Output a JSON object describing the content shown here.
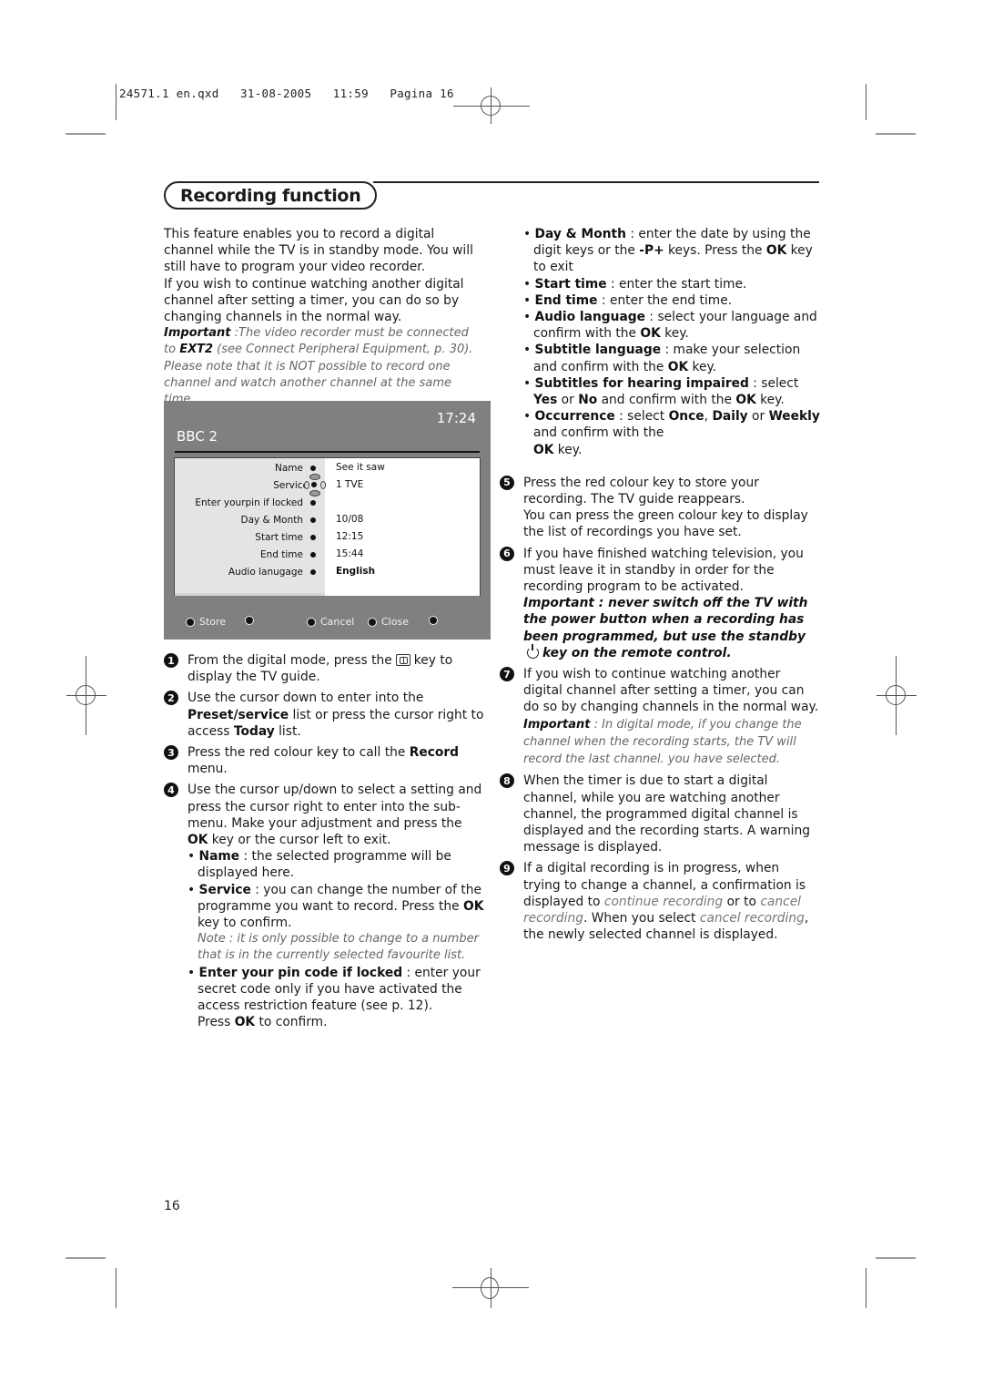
{
  "slug": "24571.1 en.qxd   31-08-2005   11:59   Pagina 16",
  "title": "Recording function",
  "intro": {
    "p1": "This feature enables you to record a digital channel while the TV is in standby mode. You will still have to program your video recorder.",
    "p2": "If you wish to continue watching another digital channel after setting a timer, you can do so by changing channels in the normal way.",
    "important_label": "Important",
    "important_text1": " :The video recorder must be connected to ",
    "ext2": "EXT2",
    "important_text2": " (see Connect Peripheral Equipment, p. 30). Please note that it is NOT possible to record one channel and watch another channel at the same time."
  },
  "tv_screen": {
    "time": "17:24",
    "channel": "BBC 2",
    "rows": [
      {
        "label": "Name",
        "value": "See it saw"
      },
      {
        "label": "Service",
        "value": "1 TVE"
      },
      {
        "label": "Enter yourpin if locked",
        "value": ""
      },
      {
        "label": "Day & Month",
        "value": "10/08"
      },
      {
        "label": "Start time",
        "value": "12:15"
      },
      {
        "label": "End time",
        "value": "15:44"
      },
      {
        "label": "Audio lanugage",
        "value": "English"
      }
    ],
    "footer": {
      "store": "Store",
      "cancel": "Cancel",
      "close": "Close"
    }
  },
  "steps": {
    "s1": {
      "num": "1",
      "a": "From the digital mode, press the",
      "b": "key to display the TV guide."
    },
    "s2": {
      "num": "2",
      "a": "Use the cursor down to enter into the ",
      "b1": "Preset/service",
      "c": " list or press the cursor right to access ",
      "b2": "Today",
      "d": " list."
    },
    "s3": {
      "num": "3",
      "a": "Press the red colour key to call the ",
      "b": "Record",
      "c": " menu."
    },
    "s4": {
      "num": "4",
      "a": "Use the cursor up/down to select a setting and press the cursor right to enter into the sub-menu. Make your adjustment and press the ",
      "ok": "OK",
      "b": " key or the cursor left to exit."
    },
    "s5": {
      "num": "5",
      "text": "Press the red colour key to store your recording. The TV guide reappears.",
      "text2": "You can press the green colour key to display the list of recordings you have set."
    },
    "s6": {
      "num": "6",
      "text": "If you have finished watching television, you must leave it in standby in order for the recording program to be activated.",
      "imp_a": "Important : never switch off the TV with the power button when a recording has been programmed, but use the standby",
      "imp_b": "key on the remote control."
    },
    "s7": {
      "num": "7",
      "text": "If you wish to continue watching another digital channel after setting a timer, you can do so by changing channels in the normal way.",
      "imp_label": "Important",
      "imp_text": " : In digital mode, if you change the channel when the recording starts, the TV will record the last channel. you have selected."
    },
    "s8": {
      "num": "8",
      "text": "When the timer is due to start a digital channel, while you are watching another channel, the programmed digital channel is displayed and the recording starts. A warning message is displayed."
    },
    "s9": {
      "num": "9",
      "a": "If a digital recording is in progress, when trying to change a channel, a confirmation is displayed to ",
      "cont": "continue recording",
      "b": " or to ",
      "canc": "cancel recording",
      "c": ". When you select ",
      "canc2": "cancel recording",
      "d": ", the newly selected channel is displayed."
    }
  },
  "settings": {
    "name": {
      "label": "Name",
      "text": " : the selected programme will be displayed here."
    },
    "service": {
      "label": "Service",
      "text": " : you can change the number of the programme you want to record. Press the ",
      "ok": "OK",
      "text2": " key to confirm."
    },
    "note": "Note : it is only possible to change to a number that is in the currently selected favourite list.",
    "pin": {
      "label": "Enter your pin code if locked",
      "text": " : enter your secret code only if you have activated the access restriction feature (see p. 12).",
      "press": "Press ",
      "ok": "OK",
      "press2": " to confirm."
    },
    "day": {
      "label": "Day & Month",
      "text": " : enter the date by using the digit keys or the ",
      "pkey": "-P+",
      "text2": " keys. Press the ",
      "ok": "OK",
      "text3": " key to exit"
    },
    "start": {
      "label": "Start time",
      "text": " : enter the start time."
    },
    "end": {
      "label": "End time",
      "text": " : enter the end time."
    },
    "audio": {
      "label": "Audio language",
      "text": " : select your language and confirm with the ",
      "ok": "OK",
      "text2": " key."
    },
    "subtitle": {
      "label": "Subtitle language",
      "text": " : make your selection and confirm with the ",
      "ok": "OK",
      "text2": " key."
    },
    "hearing": {
      "label": "Subtitles for hearing impaired",
      "text": " : select ",
      "yes": "Yes",
      "or": " or ",
      "no": "No",
      "text2": " and confirm with the ",
      "ok": "OK",
      "text3": " key."
    },
    "occurrence": {
      "label": "Occurrence",
      "text": " : select ",
      "once": "Once",
      "comma": ", ",
      "daily": "Daily",
      "or": " or ",
      "weekly": "Weekly",
      "text2": " and confirm with the",
      "ok": "OK",
      "text3": " key."
    }
  },
  "page_number": "16"
}
